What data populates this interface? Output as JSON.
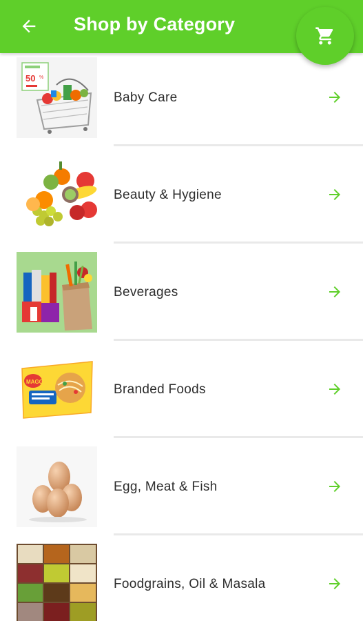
{
  "header": {
    "title": "Shop by Category",
    "back_icon": "arrow-left-icon",
    "cart_icon": "shopping-cart-icon",
    "accent_color": "#5fcf2a"
  },
  "categories": [
    {
      "label": "Baby Care",
      "image": "grocery-basket-sale-image",
      "arrow_icon": "arrow-right-icon"
    },
    {
      "label": "Beauty & Hygiene",
      "image": "fruits-image",
      "arrow_icon": "arrow-right-icon"
    },
    {
      "label": "Beverages",
      "image": "grocery-bag-image",
      "arrow_icon": "arrow-right-icon"
    },
    {
      "label": "Branded Foods",
      "image": "noodles-pack-image",
      "arrow_icon": "arrow-right-icon"
    },
    {
      "label": "Egg, Meat & Fish",
      "image": "eggs-image",
      "arrow_icon": "arrow-right-icon"
    },
    {
      "label": "Foodgrains, Oil & Masala",
      "image": "grains-box-image",
      "arrow_icon": "arrow-right-icon"
    }
  ]
}
